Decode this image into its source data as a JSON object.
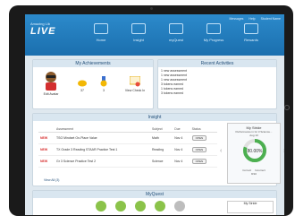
{
  "app": {
    "logo_small": "Amazing Lib",
    "logo_big": "LIVE"
  },
  "nav": [
    {
      "label": "Home"
    },
    {
      "label": "Insight"
    },
    {
      "label": "myQuest"
    },
    {
      "label": "My Progress"
    },
    {
      "label": "Rewards"
    }
  ],
  "util": {
    "messages": "Messages",
    "help": "Help",
    "user": "Student Name"
  },
  "achievements": {
    "title": "My Achievements",
    "edit_avatar": "Edit Avatar",
    "coins": "37",
    "trophies": "3",
    "checkins": "0",
    "view_checkin": "View Check In"
  },
  "recent": {
    "title": "Recent Activities",
    "items": [
      "1 new assessment",
      "1 new assessment",
      "1 new assessment",
      "3 tokens earned",
      "1 tokens earned",
      "3 tokens earned"
    ]
  },
  "insight": {
    "title": "Insight",
    "headers": {
      "assessment": "Assessment",
      "subject": "Subject",
      "due": "Due",
      "status": "Status"
    },
    "rows": [
      {
        "badge": "NEW",
        "name": "TSO Mindset On-Place Value",
        "subject": "Math",
        "due": "Nov 4",
        "status": "OPEN"
      },
      {
        "badge": "NEW",
        "name": "TX Grade 3 Reading STAAR Practice Test 1",
        "subject": "Reading",
        "due": "Nov 4",
        "status": "OPEN"
      },
      {
        "badge": "NEW",
        "name": "Gr 3 Science Practice Test 2",
        "subject": "Science",
        "due": "Nov 4",
        "status": "OPEN"
      }
    ],
    "view_all": "View All (3)"
  },
  "stride": {
    "title": "My Stride",
    "subtitle": "Performance in Gr 3 Science...",
    "date": "Aug 10",
    "percent": "80.00%",
    "legend_correct": "Correct",
    "legend_incorrect": "Incorrect",
    "score_label": "8/10"
  },
  "myquest": {
    "title": "MyQuest",
    "stride_title": "My Stride"
  },
  "colors": {
    "accent": "#1b6fae",
    "new": "#d62b2b",
    "correct": "#4caf50"
  }
}
